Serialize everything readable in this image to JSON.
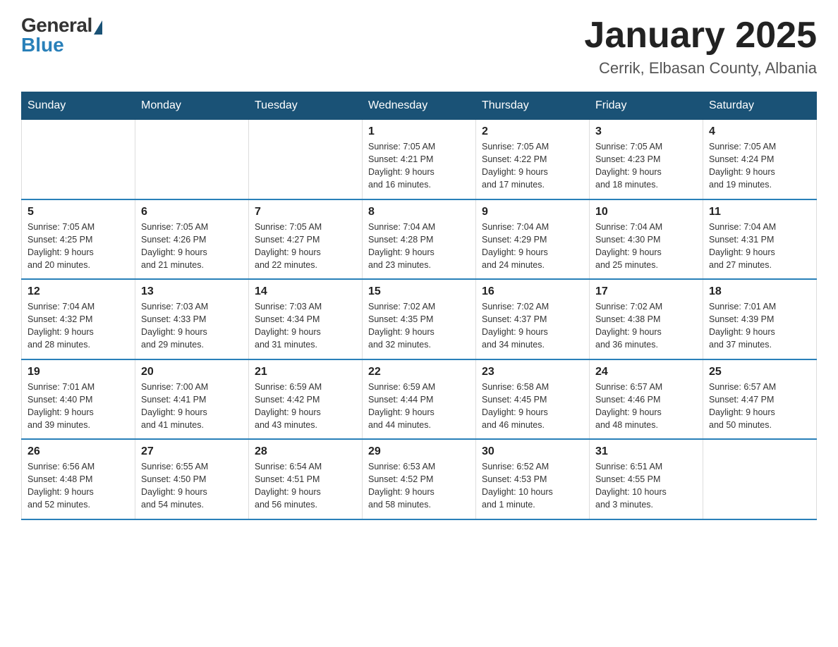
{
  "logo": {
    "general": "General",
    "blue": "Blue"
  },
  "title": "January 2025",
  "subtitle": "Cerrik, Elbasan County, Albania",
  "days_of_week": [
    "Sunday",
    "Monday",
    "Tuesday",
    "Wednesday",
    "Thursday",
    "Friday",
    "Saturday"
  ],
  "weeks": [
    [
      {
        "day": "",
        "info": ""
      },
      {
        "day": "",
        "info": ""
      },
      {
        "day": "",
        "info": ""
      },
      {
        "day": "1",
        "info": "Sunrise: 7:05 AM\nSunset: 4:21 PM\nDaylight: 9 hours\nand 16 minutes."
      },
      {
        "day": "2",
        "info": "Sunrise: 7:05 AM\nSunset: 4:22 PM\nDaylight: 9 hours\nand 17 minutes."
      },
      {
        "day": "3",
        "info": "Sunrise: 7:05 AM\nSunset: 4:23 PM\nDaylight: 9 hours\nand 18 minutes."
      },
      {
        "day": "4",
        "info": "Sunrise: 7:05 AM\nSunset: 4:24 PM\nDaylight: 9 hours\nand 19 minutes."
      }
    ],
    [
      {
        "day": "5",
        "info": "Sunrise: 7:05 AM\nSunset: 4:25 PM\nDaylight: 9 hours\nand 20 minutes."
      },
      {
        "day": "6",
        "info": "Sunrise: 7:05 AM\nSunset: 4:26 PM\nDaylight: 9 hours\nand 21 minutes."
      },
      {
        "day": "7",
        "info": "Sunrise: 7:05 AM\nSunset: 4:27 PM\nDaylight: 9 hours\nand 22 minutes."
      },
      {
        "day": "8",
        "info": "Sunrise: 7:04 AM\nSunset: 4:28 PM\nDaylight: 9 hours\nand 23 minutes."
      },
      {
        "day": "9",
        "info": "Sunrise: 7:04 AM\nSunset: 4:29 PM\nDaylight: 9 hours\nand 24 minutes."
      },
      {
        "day": "10",
        "info": "Sunrise: 7:04 AM\nSunset: 4:30 PM\nDaylight: 9 hours\nand 25 minutes."
      },
      {
        "day": "11",
        "info": "Sunrise: 7:04 AM\nSunset: 4:31 PM\nDaylight: 9 hours\nand 27 minutes."
      }
    ],
    [
      {
        "day": "12",
        "info": "Sunrise: 7:04 AM\nSunset: 4:32 PM\nDaylight: 9 hours\nand 28 minutes."
      },
      {
        "day": "13",
        "info": "Sunrise: 7:03 AM\nSunset: 4:33 PM\nDaylight: 9 hours\nand 29 minutes."
      },
      {
        "day": "14",
        "info": "Sunrise: 7:03 AM\nSunset: 4:34 PM\nDaylight: 9 hours\nand 31 minutes."
      },
      {
        "day": "15",
        "info": "Sunrise: 7:02 AM\nSunset: 4:35 PM\nDaylight: 9 hours\nand 32 minutes."
      },
      {
        "day": "16",
        "info": "Sunrise: 7:02 AM\nSunset: 4:37 PM\nDaylight: 9 hours\nand 34 minutes."
      },
      {
        "day": "17",
        "info": "Sunrise: 7:02 AM\nSunset: 4:38 PM\nDaylight: 9 hours\nand 36 minutes."
      },
      {
        "day": "18",
        "info": "Sunrise: 7:01 AM\nSunset: 4:39 PM\nDaylight: 9 hours\nand 37 minutes."
      }
    ],
    [
      {
        "day": "19",
        "info": "Sunrise: 7:01 AM\nSunset: 4:40 PM\nDaylight: 9 hours\nand 39 minutes."
      },
      {
        "day": "20",
        "info": "Sunrise: 7:00 AM\nSunset: 4:41 PM\nDaylight: 9 hours\nand 41 minutes."
      },
      {
        "day": "21",
        "info": "Sunrise: 6:59 AM\nSunset: 4:42 PM\nDaylight: 9 hours\nand 43 minutes."
      },
      {
        "day": "22",
        "info": "Sunrise: 6:59 AM\nSunset: 4:44 PM\nDaylight: 9 hours\nand 44 minutes."
      },
      {
        "day": "23",
        "info": "Sunrise: 6:58 AM\nSunset: 4:45 PM\nDaylight: 9 hours\nand 46 minutes."
      },
      {
        "day": "24",
        "info": "Sunrise: 6:57 AM\nSunset: 4:46 PM\nDaylight: 9 hours\nand 48 minutes."
      },
      {
        "day": "25",
        "info": "Sunrise: 6:57 AM\nSunset: 4:47 PM\nDaylight: 9 hours\nand 50 minutes."
      }
    ],
    [
      {
        "day": "26",
        "info": "Sunrise: 6:56 AM\nSunset: 4:48 PM\nDaylight: 9 hours\nand 52 minutes."
      },
      {
        "day": "27",
        "info": "Sunrise: 6:55 AM\nSunset: 4:50 PM\nDaylight: 9 hours\nand 54 minutes."
      },
      {
        "day": "28",
        "info": "Sunrise: 6:54 AM\nSunset: 4:51 PM\nDaylight: 9 hours\nand 56 minutes."
      },
      {
        "day": "29",
        "info": "Sunrise: 6:53 AM\nSunset: 4:52 PM\nDaylight: 9 hours\nand 58 minutes."
      },
      {
        "day": "30",
        "info": "Sunrise: 6:52 AM\nSunset: 4:53 PM\nDaylight: 10 hours\nand 1 minute."
      },
      {
        "day": "31",
        "info": "Sunrise: 6:51 AM\nSunset: 4:55 PM\nDaylight: 10 hours\nand 3 minutes."
      },
      {
        "day": "",
        "info": ""
      }
    ]
  ]
}
